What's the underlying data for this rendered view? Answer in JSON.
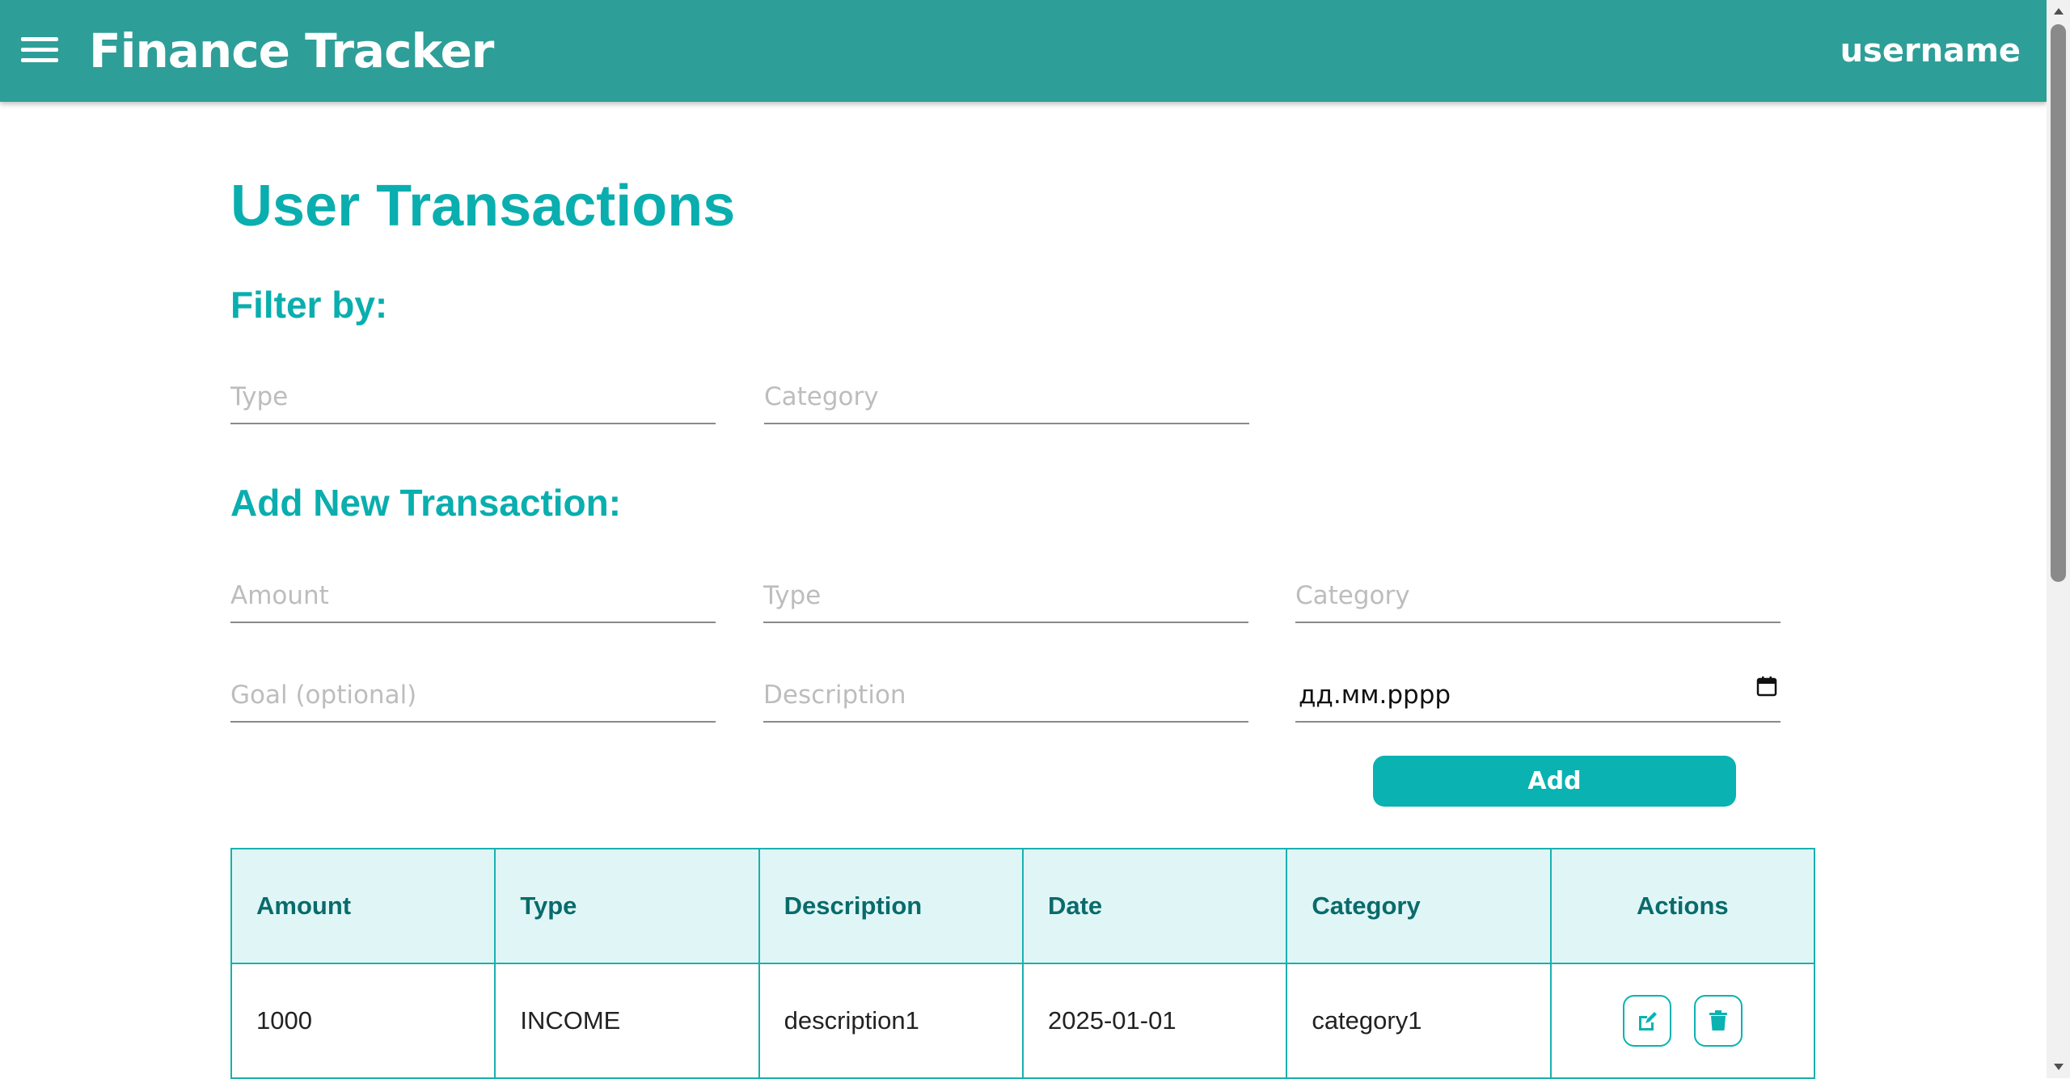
{
  "header": {
    "title": "Finance Tracker",
    "username": "username"
  },
  "main": {
    "page_title": "User Transactions",
    "filter": {
      "heading": "Filter by:",
      "type_placeholder": "Type",
      "category_placeholder": "Category"
    },
    "add_form": {
      "heading": "Add New Transaction:",
      "amount_placeholder": "Amount",
      "type_placeholder": "Type",
      "category_placeholder": "Category",
      "goal_placeholder": "Goal (optional)",
      "description_placeholder": "Description",
      "date_placeholder": "дд.мм.рррр",
      "add_label": "Add"
    },
    "table": {
      "columns": [
        "Amount",
        "Type",
        "Description",
        "Date",
        "Category",
        "Actions"
      ],
      "rows": [
        {
          "amount": "1000",
          "type": "INCOME",
          "description": "description1",
          "date": "2025-01-01",
          "category": "category1"
        }
      ]
    }
  },
  "icons": {
    "menu": "hamburger-menu-icon",
    "calendar": "calendar-icon",
    "edit": "edit-icon",
    "delete": "trash-icon"
  },
  "colors": {
    "appbar": "#2e9e98",
    "accent": "#0aaeae",
    "table_header_bg": "#e0f6f6",
    "table_header_text": "#0a6b6b"
  }
}
